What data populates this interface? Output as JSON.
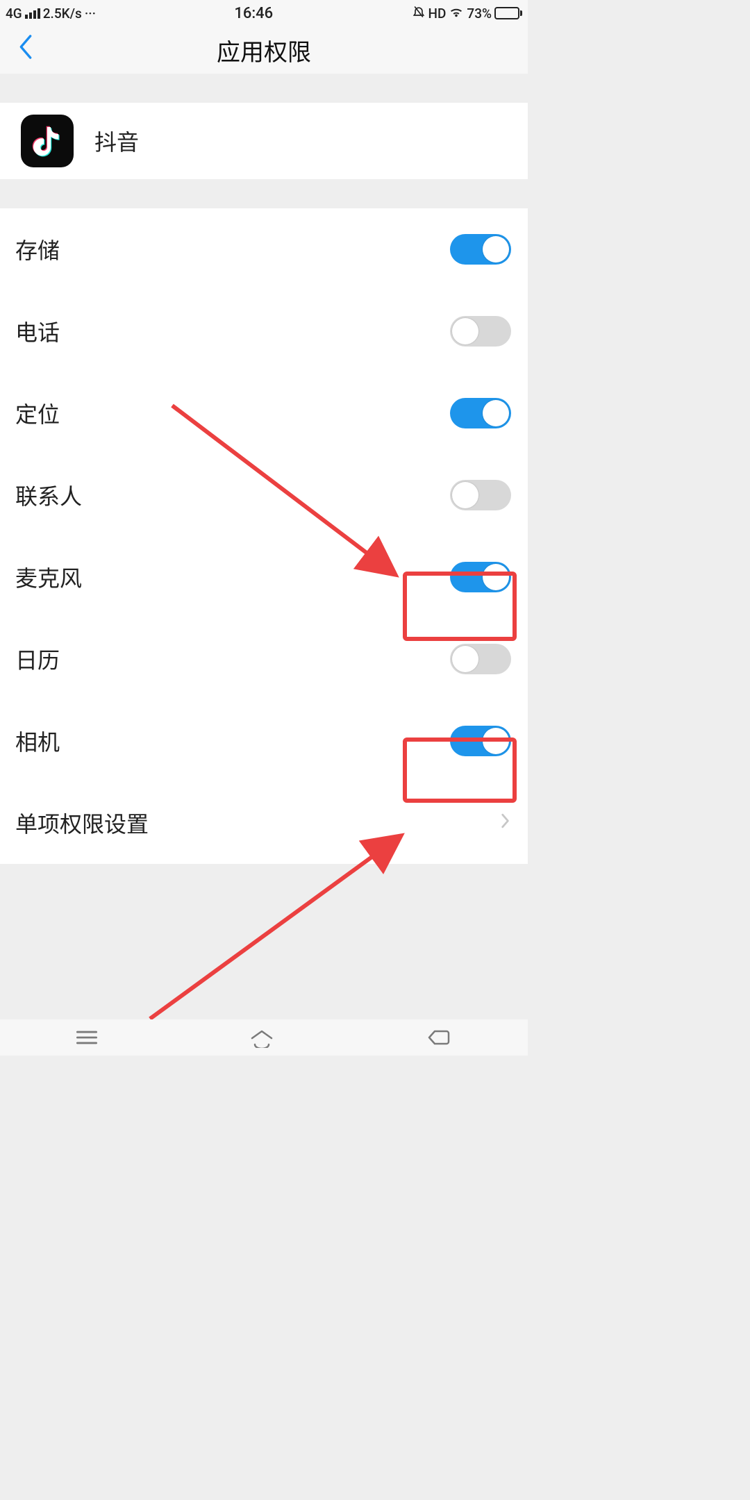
{
  "status": {
    "net_type": "4G",
    "speed": "2.5K/s",
    "more": "···",
    "time": "16:46",
    "hd": "HD",
    "battery_pct": "73%"
  },
  "header": {
    "title": "应用权限"
  },
  "app": {
    "name": "抖音"
  },
  "perms": [
    {
      "label": "存储",
      "on": true
    },
    {
      "label": "电话",
      "on": false
    },
    {
      "label": "定位",
      "on": true
    },
    {
      "label": "联系人",
      "on": false
    },
    {
      "label": "麦克风",
      "on": true
    },
    {
      "label": "日历",
      "on": false
    },
    {
      "label": "相机",
      "on": true
    }
  ],
  "more_item": {
    "label": "单项权限设置"
  }
}
